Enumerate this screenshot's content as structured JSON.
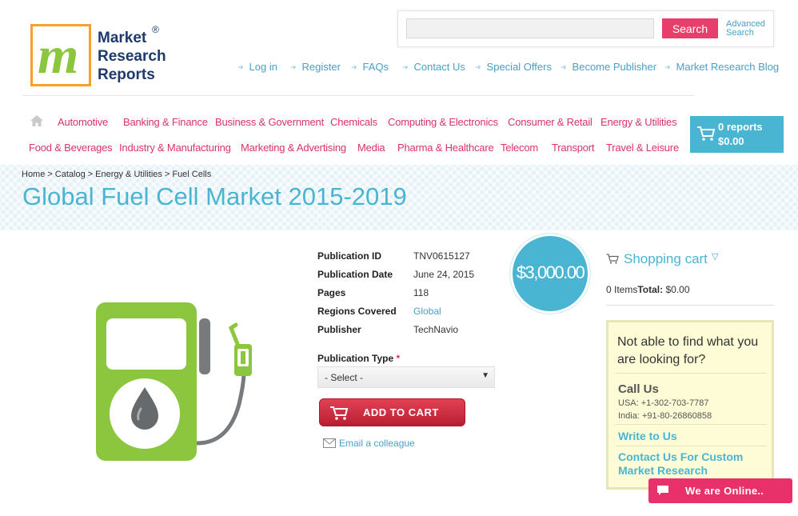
{
  "logo": {
    "line1": "Market",
    "line2": "Research",
    "line3": "Reports",
    "mark": "®"
  },
  "search": {
    "placeholder": "",
    "button": "Search",
    "advanced_line1": "Advanced",
    "advanced_line2": "Search"
  },
  "toplinks": [
    "Log in",
    "Register",
    "FAQs",
    "Contact Us",
    "Special Offers",
    "Become Publisher",
    "Market Research Blog"
  ],
  "categories_row1": [
    "Automotive",
    "Banking & Finance",
    "Business & Government",
    "Chemicals",
    "Computing & Electronics",
    "Consumer & Retail",
    "Energy & Utilities"
  ],
  "categories_row2": [
    "Food & Beverages",
    "Industry & Manufacturing",
    "Marketing & Advertising",
    "Media",
    "Pharma & Healthcare",
    "Telecom",
    "Transport",
    "Travel & Leisure"
  ],
  "cart": {
    "reports": "0 reports",
    "amount": "$0.00"
  },
  "breadcrumb": [
    "Home",
    "Catalog",
    "Energy & Utilities",
    "Fuel Cells"
  ],
  "breadcrumb_sep": ">",
  "title": "Global Fuel Cell Market 2015-2019",
  "details": [
    {
      "label": "Publication ID",
      "value": "TNV0615127"
    },
    {
      "label": "Publication Date",
      "value": "June 24, 2015"
    },
    {
      "label": "Pages",
      "value": "118"
    },
    {
      "label": "Regions Covered",
      "value": "Global"
    },
    {
      "label": "Publisher",
      "value": "TechNavio"
    }
  ],
  "price": "$3,000.00",
  "publication_type": {
    "label": "Publication Type",
    "required_mark": "*",
    "selected": "- Select -"
  },
  "add_to_cart": "ADD TO CART",
  "email_colleague": "Email a colleague",
  "shopping_cart": {
    "title": "Shopping cart",
    "items": "0 Items",
    "total_label": "Total:",
    "total_value": "$0.00"
  },
  "help": {
    "question": "Not able to find what you are looking for?",
    "call_us": "Call Us",
    "usa": "USA: +1-302-703-7787",
    "india": "India: +91-80-26860858",
    "write_to_us": "Write to Us",
    "custom": "Contact Us For Custom Market Research"
  },
  "chat": {
    "label": "We are Online.."
  },
  "colors": {
    "accent_blue": "#4ab5d3",
    "category_pink": "#d9336a",
    "button_red": "#c8283b",
    "search_pink": "#e83e6b",
    "pump_green": "#8cc63f"
  }
}
